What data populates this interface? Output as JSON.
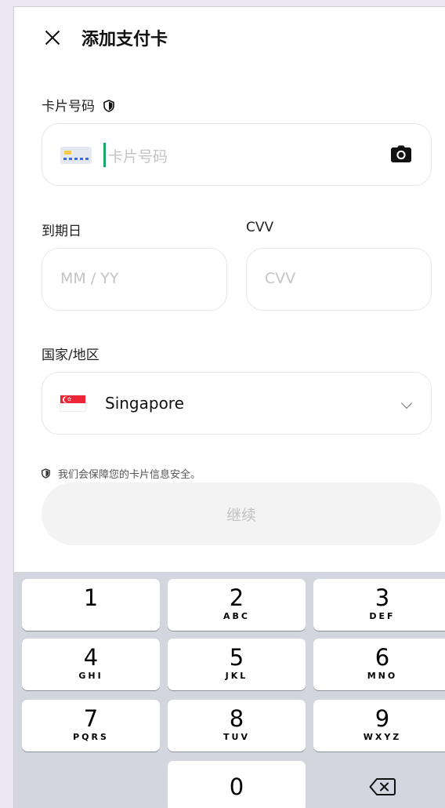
{
  "header": {
    "title": "添加支付卡"
  },
  "card_number": {
    "label": "卡片号码",
    "placeholder": "卡片号码"
  },
  "expiry": {
    "label": "到期日",
    "placeholder": "MM / YY"
  },
  "cvv": {
    "label": "CVV",
    "placeholder": "CVV"
  },
  "country": {
    "label": "国家/地区",
    "value": "Singapore"
  },
  "security_note": "我们会保障您的卡片信息安全。",
  "continue_label": "继续",
  "keyboard": {
    "keys": [
      {
        "num": "1",
        "letters": ""
      },
      {
        "num": "2",
        "letters": "ABC"
      },
      {
        "num": "3",
        "letters": "DEF"
      },
      {
        "num": "4",
        "letters": "GHI"
      },
      {
        "num": "5",
        "letters": "JKL"
      },
      {
        "num": "6",
        "letters": "MNO"
      },
      {
        "num": "7",
        "letters": "PQRS"
      },
      {
        "num": "8",
        "letters": "TUV"
      },
      {
        "num": "9",
        "letters": "WXYZ"
      },
      {
        "num": "0",
        "letters": ""
      }
    ]
  },
  "colors": {
    "accent": "#1aa56a",
    "flag_red": "#ee2536"
  }
}
